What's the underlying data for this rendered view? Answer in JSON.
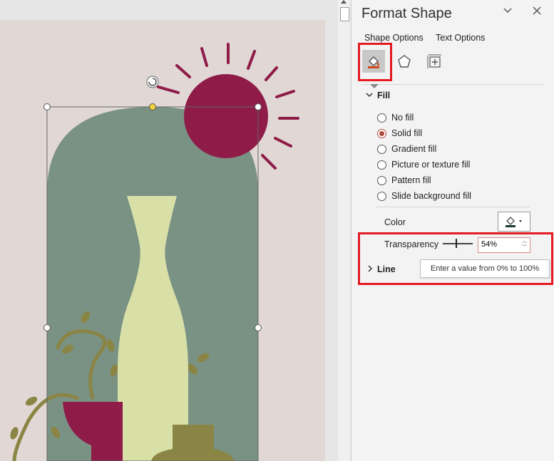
{
  "pane": {
    "title": "Format Shape",
    "tabs": [
      "Shape Options",
      "Text Options"
    ],
    "icons": [
      "fill-and-line-icon",
      "effects-icon",
      "size-and-properties-icon"
    ],
    "fill_section": "Fill",
    "fill_options": [
      {
        "label": "No fill",
        "selected": false
      },
      {
        "label": "Solid fill",
        "selected": true
      },
      {
        "label": "Gradient fill",
        "selected": false
      },
      {
        "label": "Picture or texture fill",
        "selected": false
      },
      {
        "label": "Pattern fill",
        "selected": false
      },
      {
        "label": "Slide background fill",
        "selected": false
      }
    ],
    "color_label": "Color",
    "transparency_label": "Transparency",
    "transparency_value": "54%",
    "tooltip": "Enter a value from 0% to 100%",
    "line_section": "Line"
  },
  "colors": {
    "slide_bg": "#e1d8d5",
    "arch": "#7a9284",
    "vase": "#d8e0a8",
    "sun": "#8e1b48",
    "olive": "#8a8545",
    "highlight": "#e31b23"
  }
}
